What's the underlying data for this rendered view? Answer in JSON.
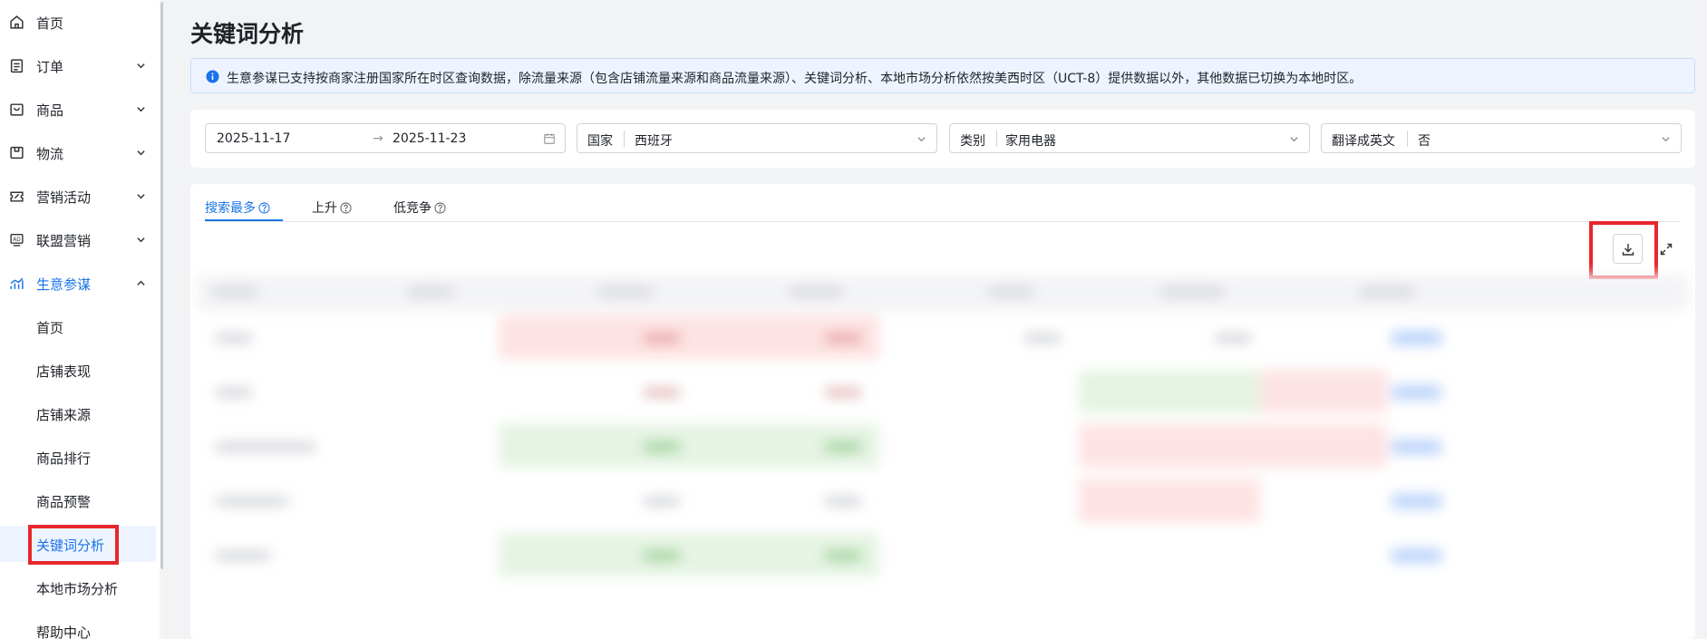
{
  "sidebar": {
    "items": [
      {
        "label": "首页",
        "icon": "home-icon"
      },
      {
        "label": "订单",
        "icon": "order-icon"
      },
      {
        "label": "商品",
        "icon": "product-icon"
      },
      {
        "label": "物流",
        "icon": "logistics-icon"
      },
      {
        "label": "营销活动",
        "icon": "marketing-icon"
      },
      {
        "label": "联盟营销",
        "icon": "affiliate-icon"
      },
      {
        "label": "生意参谋",
        "icon": "analytics-icon"
      }
    ],
    "sub_items": [
      "首页",
      "店铺表现",
      "店铺来源",
      "商品排行",
      "商品预警",
      "关键词分析",
      "本地市场分析",
      "帮助中心"
    ]
  },
  "page": {
    "title": "关键词分析",
    "notice": "生意参谋已支持按商家注册国家所在时区查询数据，除流量来源（包含店铺流量来源和商品流量来源）、关键词分析、本地市场分析依然按美西时区（UCT-8）提供数据以外，其他数据已切换为本地时区。"
  },
  "filters": {
    "date_start": "2025-11-17",
    "date_sep": "→",
    "date_end": "2025-11-23",
    "country_label": "国家",
    "country_value": "西班牙",
    "category_label": "类别",
    "category_value": "家用电器",
    "translate_label": "翻译成英文",
    "translate_value": "否"
  },
  "tabs": [
    "搜索最多",
    "上升",
    "低竞争"
  ],
  "colors": {
    "accent": "#1a73e8",
    "highlight": "#e8262d"
  }
}
